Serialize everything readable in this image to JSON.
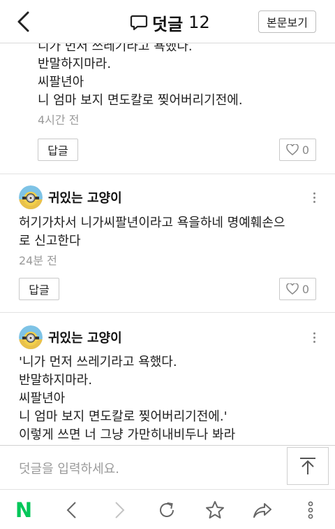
{
  "header": {
    "title": "덧글",
    "count": "12",
    "view_body_label": "본문보기"
  },
  "comments": [
    {
      "lines": [
        "니가 먼저 쓰레기라고 욕했다.",
        "반말하지마라.",
        "씨팔년아",
        "니 엄마 보지 면도칼로 찢어버리기전에."
      ],
      "time": "4시간 전",
      "reply_label": "답글",
      "likes": "0"
    },
    {
      "author": "귀있는 고양이",
      "lines": [
        "허기가차서 니가씨팔년이라고 욕을하네 명예훼손으",
        "로 신고한다"
      ],
      "time": "24분 전",
      "reply_label": "답글",
      "likes": "0"
    },
    {
      "author": "귀있는 고양이",
      "lines": [
        "'니가 먼저 쓰레기라고 욕했다.",
        "반말하지마라.",
        "씨팔년아",
        "니 엄마 보지 면도칼로 찢어버리기전에.'",
        "이렇게 쓰면 너 그냥 가만히내비두나 봐라"
      ]
    }
  ],
  "input": {
    "placeholder": "덧글을 입력하세요."
  },
  "browser_bar": {
    "home_letter": "N",
    "brand_color": "#03c75a"
  },
  "colors": {
    "separator": "#e2e2e2",
    "muted_text": "#9a9a9a"
  }
}
